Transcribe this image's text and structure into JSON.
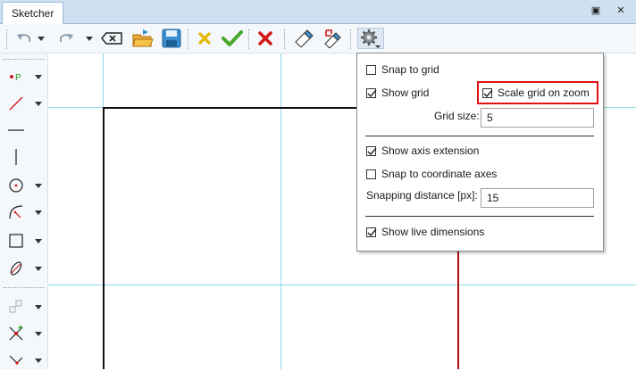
{
  "window": {
    "tab_title": "Sketcher",
    "restore_glyph": "▣",
    "close_glyph": "✕"
  },
  "toolbar": {
    "items": [
      "undo-icon",
      "redo-icon",
      "dropdown-icon",
      "backspace-icon",
      "open-folder-icon",
      "save-icon",
      "cancel-x-icon",
      "confirm-check-icon",
      "delete-x-icon",
      "eraser-icon",
      "edit-clear-icon",
      "settings-gear-icon"
    ]
  },
  "left_toolbar": {
    "items": [
      "point-icon",
      "line-icon",
      "horizontal-line-icon",
      "vertical-line-icon",
      "circle-icon",
      "arc-icon",
      "rectangle-icon",
      "ellipse-icon",
      "constraint-icon",
      "intersection-icon",
      "perpendicular-icon"
    ]
  },
  "settings_popup": {
    "snap_to_grid": {
      "label": "Snap to grid",
      "checked": false
    },
    "show_grid": {
      "label": "Show grid",
      "checked": true
    },
    "scale_grid_on_zoom": {
      "label": "Scale grid on zoom",
      "checked": true
    },
    "grid_size": {
      "label": "Grid size:",
      "value": "5"
    },
    "show_axis_extension": {
      "label": "Show axis extension",
      "checked": true
    },
    "snap_to_coordinate_axes": {
      "label": "Snap to coordinate axes",
      "checked": false
    },
    "snapping_distance": {
      "label": "Snapping distance [px]:",
      "value": "15"
    },
    "show_live_dimensions": {
      "label": "Show live dimensions",
      "checked": true
    }
  },
  "colors": {
    "grid_line": "#8fd8ea",
    "axis_red": "#b01010",
    "highlight": "#e01010"
  }
}
